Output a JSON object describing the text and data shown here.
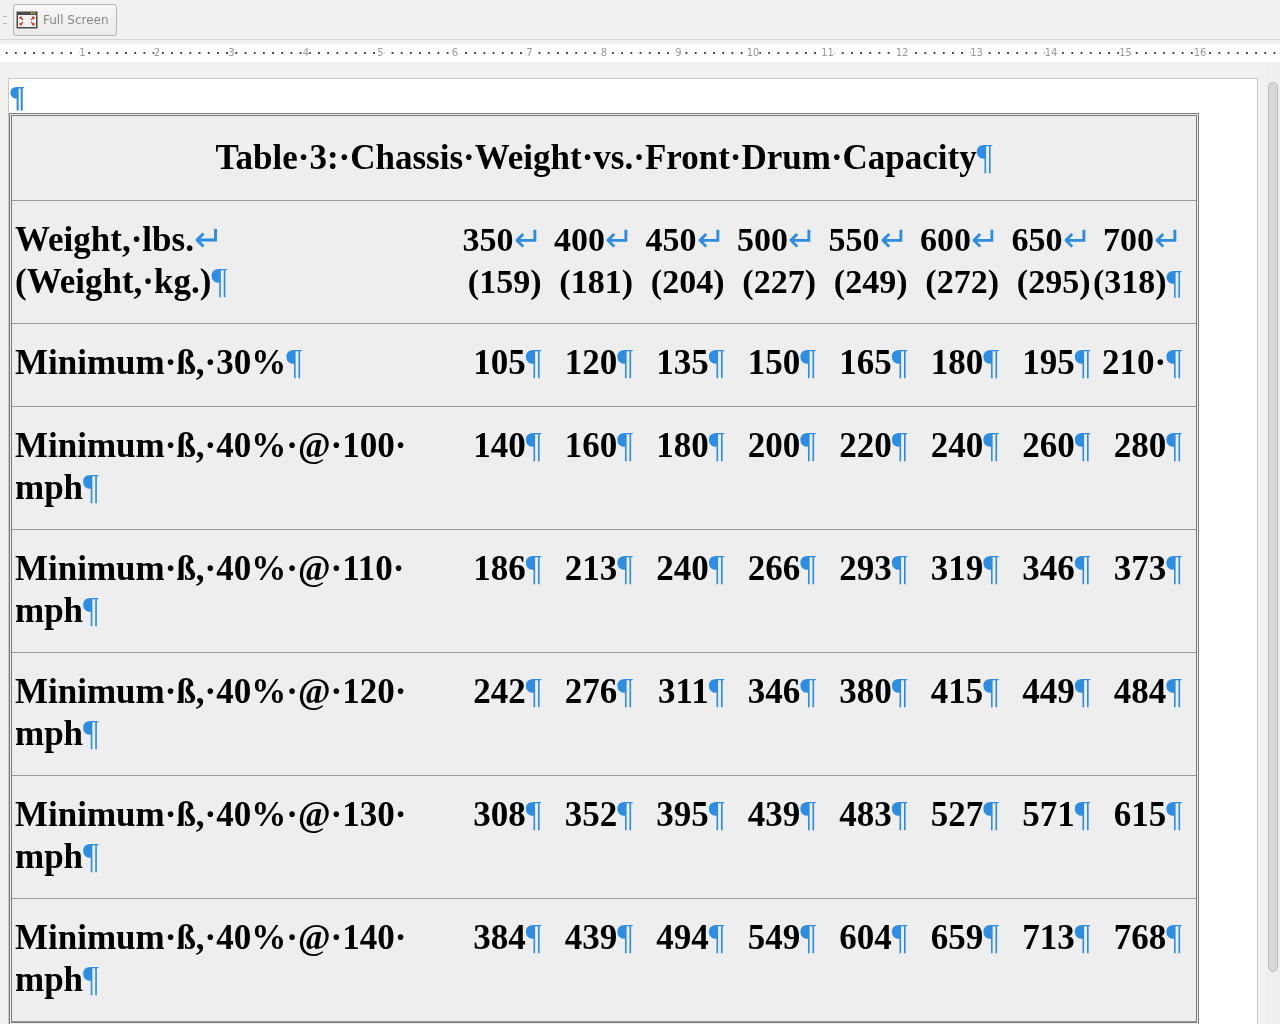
{
  "toolbar": {
    "buttons": [
      {
        "label": "Full Screen",
        "disabled": true
      }
    ]
  },
  "ruler": {
    "labels": [
      "1",
      "2",
      "3",
      "4",
      "5",
      "6",
      "7",
      "8",
      "9",
      "10",
      "11",
      "12",
      "13",
      "14",
      "15",
      "16"
    ]
  },
  "document": {
    "empty_paragraph_mark": "¶",
    "table": {
      "title": {
        "text": "Table·3:·Chassis·Weight·vs.·Front·Drum·Capacity",
        "mark": "¶"
      },
      "rows": [
        {
          "label": [
            {
              "text": "Weight,·lbs.",
              "mark": "↵"
            },
            {
              "text": "(Weight,·kg.)",
              "mark": "¶"
            }
          ],
          "cells": [
            [
              {
                "text": "350",
                "mark": "↵"
              },
              {
                "text": "(159)"
              }
            ],
            [
              {
                "text": "400",
                "mark": "↵"
              },
              {
                "text": "(181)"
              }
            ],
            [
              {
                "text": "450",
                "mark": "↵"
              },
              {
                "text": "(204)"
              }
            ],
            [
              {
                "text": "500",
                "mark": "↵"
              },
              {
                "text": "(227)"
              }
            ],
            [
              {
                "text": "550",
                "mark": "↵"
              },
              {
                "text": "(249)"
              }
            ],
            [
              {
                "text": "600",
                "mark": "↵"
              },
              {
                "text": "(272)"
              }
            ],
            [
              {
                "text": "650",
                "mark": "↵"
              },
              {
                "text": "(295)"
              }
            ],
            [
              {
                "text": "700",
                "mark": "↵"
              },
              {
                "text": "(318)",
                "mark": "¶"
              }
            ]
          ]
        },
        {
          "label": [
            {
              "text": "Minimum·ß,·30%",
              "mark": "¶"
            }
          ],
          "cells": [
            [
              {
                "text": "105",
                "mark": "¶"
              }
            ],
            [
              {
                "text": "120",
                "mark": "¶"
              }
            ],
            [
              {
                "text": "135",
                "mark": "¶"
              }
            ],
            [
              {
                "text": "150",
                "mark": "¶"
              }
            ],
            [
              {
                "text": "165",
                "mark": "¶"
              }
            ],
            [
              {
                "text": "180",
                "mark": "¶"
              }
            ],
            [
              {
                "text": "195",
                "mark": "¶"
              }
            ],
            [
              {
                "text": "210·",
                "mark": "¶"
              }
            ]
          ]
        },
        {
          "label": [
            {
              "text": "Minimum·ß,·40%·@·100·"
            },
            {
              "text": "mph",
              "mark": "¶"
            }
          ],
          "cells": [
            [
              {
                "text": "140",
                "mark": "¶"
              }
            ],
            [
              {
                "text": "160",
                "mark": "¶"
              }
            ],
            [
              {
                "text": "180",
                "mark": "¶"
              }
            ],
            [
              {
                "text": "200",
                "mark": "¶"
              }
            ],
            [
              {
                "text": "220",
                "mark": "¶"
              }
            ],
            [
              {
                "text": "240",
                "mark": "¶"
              }
            ],
            [
              {
                "text": "260",
                "mark": "¶"
              }
            ],
            [
              {
                "text": "280",
                "mark": "¶"
              }
            ]
          ]
        },
        {
          "label": [
            {
              "text": "Minimum·ß,·40%·@·110·"
            },
            {
              "text": "mph",
              "mark": "¶"
            }
          ],
          "cells": [
            [
              {
                "text": "186",
                "mark": "¶"
              }
            ],
            [
              {
                "text": "213",
                "mark": "¶"
              }
            ],
            [
              {
                "text": "240",
                "mark": "¶"
              }
            ],
            [
              {
                "text": "266",
                "mark": "¶"
              }
            ],
            [
              {
                "text": "293",
                "mark": "¶"
              }
            ],
            [
              {
                "text": "319",
                "mark": "¶"
              }
            ],
            [
              {
                "text": "346",
                "mark": "¶"
              }
            ],
            [
              {
                "text": "373",
                "mark": "¶"
              }
            ]
          ]
        },
        {
          "label": [
            {
              "text": "Minimum·ß,·40%·@·120·"
            },
            {
              "text": "mph",
              "mark": "¶"
            }
          ],
          "cells": [
            [
              {
                "text": "242",
                "mark": "¶"
              }
            ],
            [
              {
                "text": "276",
                "mark": "¶"
              }
            ],
            [
              {
                "text": "311",
                "mark": "¶"
              }
            ],
            [
              {
                "text": "346",
                "mark": "¶"
              }
            ],
            [
              {
                "text": "380",
                "mark": "¶"
              }
            ],
            [
              {
                "text": "415",
                "mark": "¶"
              }
            ],
            [
              {
                "text": "449",
                "mark": "¶"
              }
            ],
            [
              {
                "text": "484",
                "mark": "¶"
              }
            ]
          ]
        },
        {
          "label": [
            {
              "text": "Minimum·ß,·40%·@·130·"
            },
            {
              "text": "mph",
              "mark": "¶"
            }
          ],
          "cells": [
            [
              {
                "text": "308",
                "mark": "¶"
              }
            ],
            [
              {
                "text": "352",
                "mark": "¶"
              }
            ],
            [
              {
                "text": "395",
                "mark": "¶"
              }
            ],
            [
              {
                "text": "439",
                "mark": "¶"
              }
            ],
            [
              {
                "text": "483",
                "mark": "¶"
              }
            ],
            [
              {
                "text": "527",
                "mark": "¶"
              }
            ],
            [
              {
                "text": "571",
                "mark": "¶"
              }
            ],
            [
              {
                "text": "615",
                "mark": "¶"
              }
            ]
          ]
        },
        {
          "label": [
            {
              "text": "Minimum·ß,·40%·@·140·"
            },
            {
              "text": "mph",
              "mark": "¶"
            }
          ],
          "cells": [
            [
              {
                "text": "384",
                "mark": "¶"
              }
            ],
            [
              {
                "text": "439",
                "mark": "¶"
              }
            ],
            [
              {
                "text": "494",
                "mark": "¶"
              }
            ],
            [
              {
                "text": "549",
                "mark": "¶"
              }
            ],
            [
              {
                "text": "604",
                "mark": "¶"
              }
            ],
            [
              {
                "text": "659",
                "mark": "¶"
              }
            ],
            [
              {
                "text": "713",
                "mark": "¶"
              }
            ],
            [
              {
                "text": "768",
                "mark": "¶"
              }
            ]
          ]
        }
      ]
    }
  }
}
